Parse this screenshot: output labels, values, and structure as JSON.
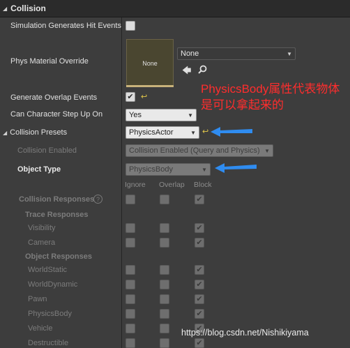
{
  "header": {
    "title": "Collision"
  },
  "simulation": {
    "label": "Simulation Generates Hit Events"
  },
  "phys_material": {
    "label": "Phys Material Override",
    "thumb_label": "None",
    "value": "None"
  },
  "overlap": {
    "label": "Generate Overlap Events"
  },
  "step_up": {
    "label": "Can Character Step Up On",
    "value": "Yes"
  },
  "presets": {
    "label": "Collision Presets",
    "value": "PhysicsActor"
  },
  "collision_enabled": {
    "label": "Collision Enabled",
    "value": "Collision Enabled (Query and Physics)"
  },
  "object_type": {
    "label": "Object Type",
    "value": "PhysicsBody"
  },
  "columns": {
    "ignore": "Ignore",
    "overlap": "Overlap",
    "block": "Block"
  },
  "responses": {
    "label": "Collision Responses",
    "trace_label": "Trace Responses",
    "object_label": "Object Responses",
    "trace_items": [
      "Visibility",
      "Camera"
    ],
    "object_items": [
      "WorldStatic",
      "WorldDynamic",
      "Pawn",
      "PhysicsBody",
      "Vehicle",
      "Destructible"
    ]
  },
  "annotation": {
    "text": "PhysicsBody属性代表物体是可以拿起来的"
  },
  "watermark": {
    "text": "https://blog.csdn.net/Nishikiyama"
  },
  "colors": {
    "annotation": "#ff2d2d",
    "arrow": "#2f8cf0",
    "reset": "#e3c84a"
  }
}
